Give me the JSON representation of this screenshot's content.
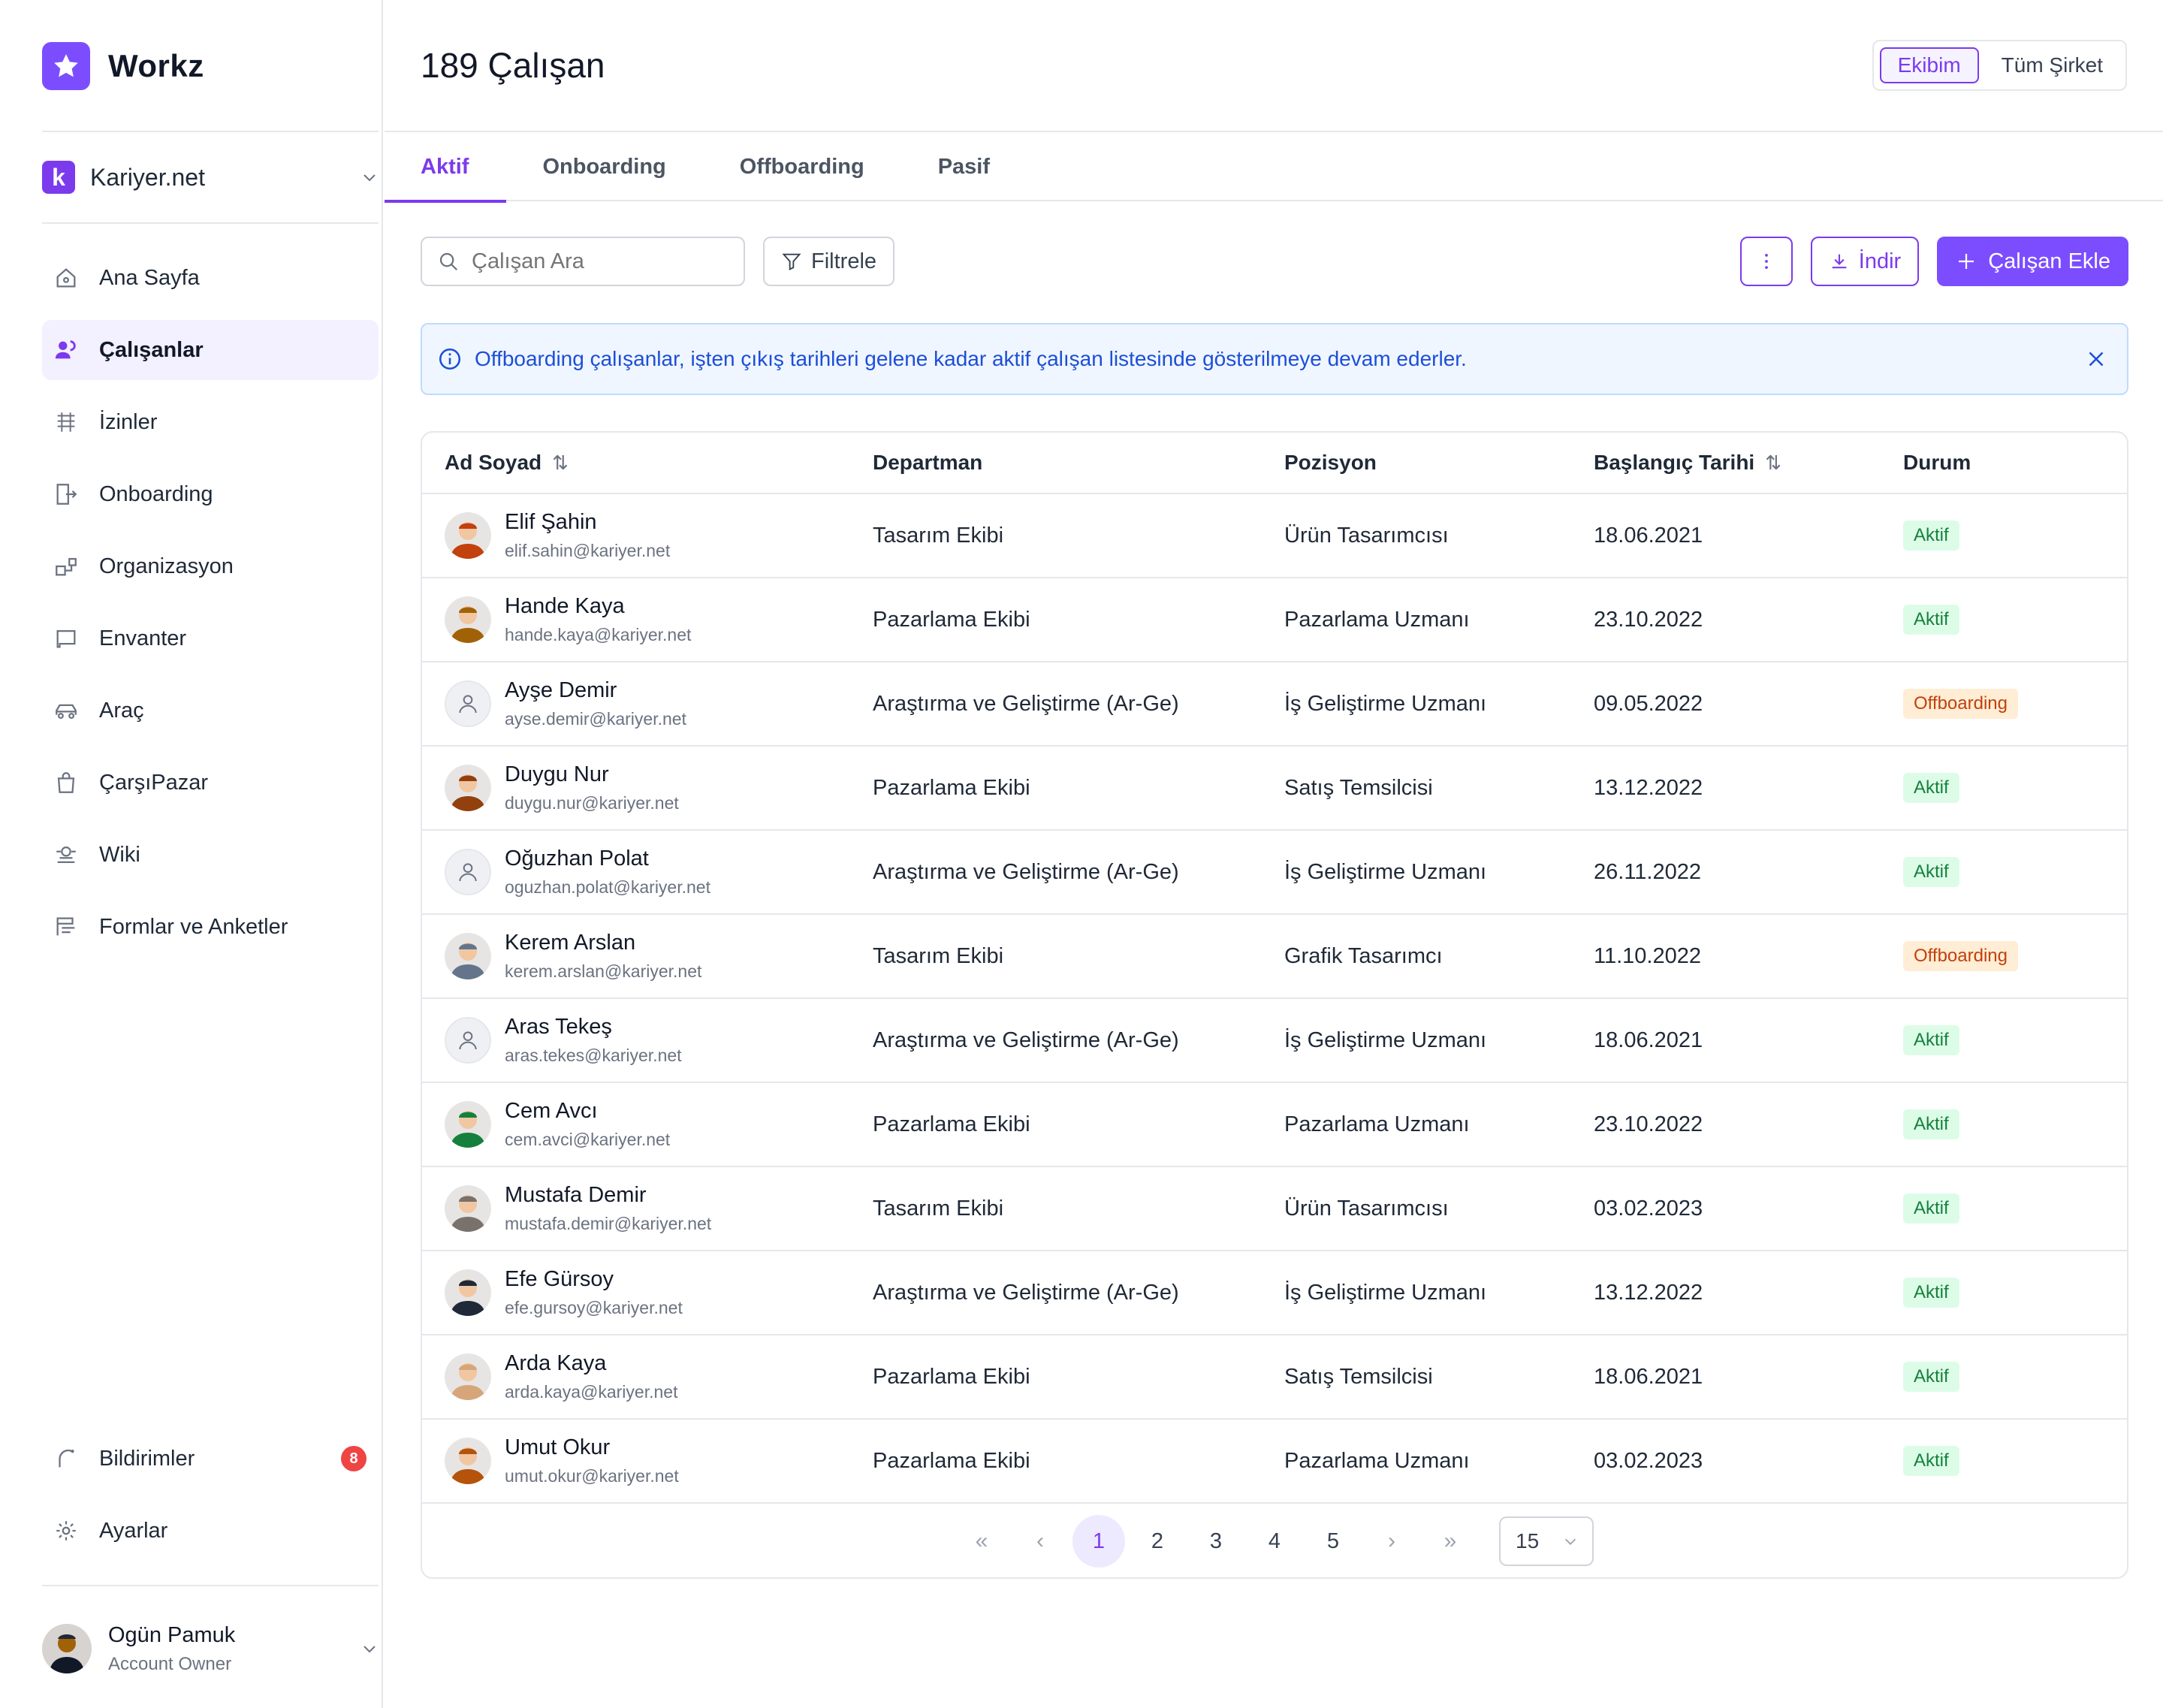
{
  "app": {
    "name": "Workz"
  },
  "company": {
    "name": "Kariyer.net",
    "logo_letter": "k"
  },
  "nav": {
    "items": [
      {
        "label": "Ana Sayfa",
        "icon": "home-icon"
      },
      {
        "label": "Çalışanlar",
        "icon": "users-icon",
        "active": true
      },
      {
        "label": "İzinler",
        "icon": "calendar-icon"
      },
      {
        "label": "Onboarding",
        "icon": "onboarding-icon"
      },
      {
        "label": "Organizasyon",
        "icon": "org-icon"
      },
      {
        "label": "Envanter",
        "icon": "inventory-icon"
      },
      {
        "label": "Araç",
        "icon": "car-icon"
      },
      {
        "label": "ÇarşıPazar",
        "icon": "shopping-bag-icon"
      },
      {
        "label": "Wiki",
        "icon": "wiki-icon"
      },
      {
        "label": "Formlar ve Anketler",
        "icon": "forms-icon"
      }
    ],
    "bottom": [
      {
        "label": "Bildirimler",
        "icon": "bell-icon",
        "badge": "8"
      },
      {
        "label": "Ayarlar",
        "icon": "settings-icon"
      }
    ]
  },
  "profile": {
    "name": "Ogün Pamuk",
    "role": "Account Owner"
  },
  "header": {
    "title": "189 Çalışan",
    "scope": {
      "options": [
        "Ekibim",
        "Tüm Şirket"
      ],
      "selected": "Ekibim"
    }
  },
  "tabs": [
    {
      "label": "Aktif",
      "active": true
    },
    {
      "label": "Onboarding"
    },
    {
      "label": "Offboarding"
    },
    {
      "label": "Pasif"
    }
  ],
  "toolbar": {
    "search_placeholder": "Çalışan Ara",
    "filter_label": "Filtrele",
    "download_label": "İndir",
    "add_label": "Çalışan Ekle"
  },
  "alert": {
    "text": "Offboarding çalışanlar, işten çıkış tarihleri gelene kadar aktif çalışan listesinde gösterilmeye devam ederler."
  },
  "table": {
    "columns": [
      "Ad Soyad",
      "Departman",
      "Pozisyon",
      "Başlangıç Tarihi",
      "Durum"
    ],
    "rows": [
      {
        "name": "Elif Şahin",
        "email": "elif.sahin@kariyer.net",
        "dept": "Tasarım Ekibi",
        "pos": "Ürün Tasarımcısı",
        "date": "18.06.2021",
        "status": "Aktif",
        "avatar": "photo",
        "tone": "#c2410c"
      },
      {
        "name": "Hande Kaya",
        "email": "hande.kaya@kariyer.net",
        "dept": "Pazarlama Ekibi",
        "pos": "Pazarlama Uzmanı",
        "date": "23.10.2022",
        "status": "Aktif",
        "avatar": "photo",
        "tone": "#a16207"
      },
      {
        "name": "Ayşe Demir",
        "email": "ayse.demir@kariyer.net",
        "dept": "Araştırma ve Geliştirme (Ar-Ge)",
        "pos": "İş Geliştirme Uzmanı",
        "date": "09.05.2022",
        "status": "Offboarding",
        "avatar": "placeholder"
      },
      {
        "name": "Duygu Nur",
        "email": "duygu.nur@kariyer.net",
        "dept": "Pazarlama Ekibi",
        "pos": "Satış Temsilcisi",
        "date": "13.12.2022",
        "status": "Aktif",
        "avatar": "photo",
        "tone": "#92400e"
      },
      {
        "name": "Oğuzhan Polat",
        "email": "oguzhan.polat@kariyer.net",
        "dept": "Araştırma ve Geliştirme (Ar-Ge)",
        "pos": "İş Geliştirme Uzmanı",
        "date": "26.11.2022",
        "status": "Aktif",
        "avatar": "placeholder"
      },
      {
        "name": "Kerem Arslan",
        "email": "kerem.arslan@kariyer.net",
        "dept": "Tasarım Ekibi",
        "pos": "Grafik Tasarımcı",
        "date": "11.10.2022",
        "status": "Offboarding",
        "avatar": "photo",
        "tone": "#64748b"
      },
      {
        "name": "Aras Tekeş",
        "email": "aras.tekes@kariyer.net",
        "dept": "Araştırma ve Geliştirme (Ar-Ge)",
        "pos": "İş Geliştirme Uzmanı",
        "date": "18.06.2021",
        "status": "Aktif",
        "avatar": "placeholder"
      },
      {
        "name": "Cem Avcı",
        "email": "cem.avci@kariyer.net",
        "dept": "Pazarlama Ekibi",
        "pos": "Pazarlama Uzmanı",
        "date": "23.10.2022",
        "status": "Aktif",
        "avatar": "photo",
        "tone": "#15803d"
      },
      {
        "name": "Mustafa Demir",
        "email": "mustafa.demir@kariyer.net",
        "dept": "Tasarım Ekibi",
        "pos": "Ürün Tasarımcısı",
        "date": "03.02.2023",
        "status": "Aktif",
        "avatar": "photo",
        "tone": "#78716c"
      },
      {
        "name": "Efe Gürsoy",
        "email": "efe.gursoy@kariyer.net",
        "dept": "Araştırma ve Geliştirme (Ar-Ge)",
        "pos": "İş Geliştirme Uzmanı",
        "date": "13.12.2022",
        "status": "Aktif",
        "avatar": "photo",
        "tone": "#1f2937"
      },
      {
        "name": "Arda Kaya",
        "email": "arda.kaya@kariyer.net",
        "dept": "Pazarlama Ekibi",
        "pos": "Satış Temsilcisi",
        "date": "18.06.2021",
        "status": "Aktif",
        "avatar": "photo",
        "tone": "#d6a67a"
      },
      {
        "name": "Umut Okur",
        "email": "umut.okur@kariyer.net",
        "dept": "Pazarlama Ekibi",
        "pos": "Pazarlama Uzmanı",
        "date": "03.02.2023",
        "status": "Aktif",
        "avatar": "photo",
        "tone": "#b45309"
      }
    ]
  },
  "pagination": {
    "pages": [
      "1",
      "2",
      "3",
      "4",
      "5"
    ],
    "current": "1",
    "per_page": "15"
  },
  "colors": {
    "accent": "#7c4dff",
    "active_status": "#15803d",
    "offboarding_status": "#c2410c",
    "alert_text": "#1d4ed8",
    "notification_badge": "#ef4444"
  }
}
